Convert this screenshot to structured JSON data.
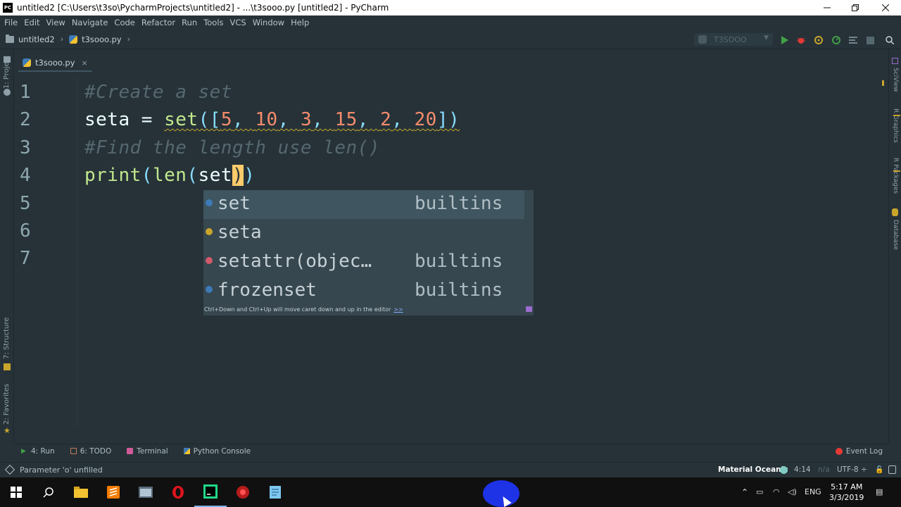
{
  "window": {
    "title": "untitled2 [C:\\Users\\t3so\\PycharmProjects\\untitled2] - ...\\t3sooo.py [untitled2] - PyCharm",
    "app_icon_text": "PC"
  },
  "menu": [
    "File",
    "Edit",
    "View",
    "Navigate",
    "Code",
    "Refactor",
    "Run",
    "Tools",
    "VCS",
    "Window",
    "Help"
  ],
  "navbar": {
    "project": "untitled2",
    "file": "t3sooo.py",
    "run_config": "T3SOOO"
  },
  "left_tools": {
    "project": "1: Project",
    "structure": "7: Structure",
    "favorites": "2: Favorites"
  },
  "right_tools": {
    "sciview": "SciView",
    "r_graphics": "R Graphics",
    "r_packages": "R Packages",
    "database": "Database"
  },
  "editor_tab": {
    "name": "t3sooo.py",
    "close": "×"
  },
  "code": {
    "line_numbers": [
      "1",
      "2",
      "3",
      "4",
      "5",
      "6",
      "7"
    ],
    "l1_comment": "#Create a set",
    "l2_var": "seta",
    "l2_eq": " = ",
    "l2_fn": "set",
    "l2_open": "([",
    "l2_n1": "5",
    "l2_n2": "10",
    "l2_n3": "3",
    "l2_n4": "15",
    "l2_n5": "2",
    "l2_n6": "20",
    "l2_sep": ", ",
    "l2_close": "])",
    "l3_comment": "#Find the length use len()",
    "l4_fn1": "print",
    "l4_p1": "(",
    "l4_fn2": "len",
    "l4_p2": "(",
    "l4_arg": "set",
    "l4_caret": ")",
    "l4_p3": ")"
  },
  "completion": {
    "items": [
      {
        "name": "set",
        "source": "builtins",
        "dot_color": "#3d7ab8"
      },
      {
        "name": "seta",
        "source": "",
        "dot_color": "#c9a52b"
      },
      {
        "name": "setattr(objec…",
        "source": "builtins",
        "dot_color": "#d15a6b"
      },
      {
        "name": "frozenset",
        "source": "builtins",
        "dot_color": "#3d7ab8"
      }
    ],
    "hint": "Ctrl+Down and Ctrl+Up will move caret down and up in the editor",
    "hint_link": ">>"
  },
  "tool_tabs": {
    "run": "4: Run",
    "todo": "6: TODO",
    "terminal": "Terminal",
    "python_console": "Python Console",
    "event_log": "Event Log"
  },
  "status": {
    "message": "Parameter 'o' unfilled",
    "theme": "Material Oceanic",
    "position": "4:14",
    "na": "n/a",
    "encoding": "UTF-8 ÷"
  },
  "taskbar": {
    "lang": "ENG",
    "time": "5:17 AM",
    "date": "3/3/2019"
  },
  "colors": {
    "editor_bg": "#263238",
    "comment": "#56686f",
    "function": "#c3e88d",
    "number": "#f78c6c",
    "punctuation": "#89ddff",
    "caret": "#ffcb6b"
  }
}
